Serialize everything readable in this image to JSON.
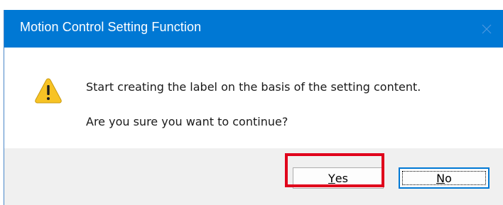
{
  "dialog": {
    "title": "Motion Control Setting Function",
    "message_line1": "Start creating the label on the basis of the setting content.",
    "message_line2": "Are you sure you want to continue?",
    "icon": "warning-icon"
  },
  "buttons": {
    "yes": {
      "mnemonic": "Y",
      "rest": "es"
    },
    "no": {
      "mnemonic": "N",
      "rest": "o"
    }
  },
  "colors": {
    "titlebar": "#0078d4",
    "highlight": "#e0001b",
    "footer": "#f0f0f0",
    "warning": "#f7c325"
  }
}
